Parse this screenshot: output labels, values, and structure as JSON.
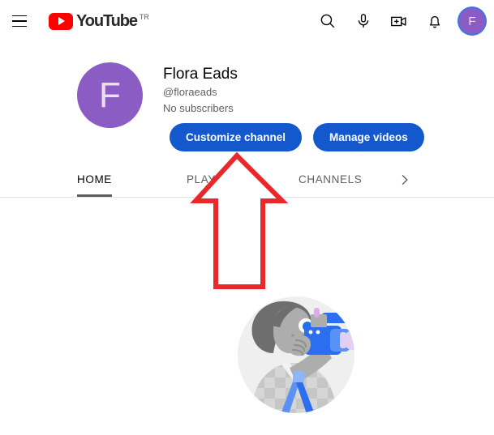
{
  "masthead": {
    "menu_icon": "hamburger-menu-icon",
    "logo_text": "YouTube",
    "country_code": "TR",
    "icons": [
      {
        "name": "search-icon",
        "label": "Search"
      },
      {
        "name": "microphone-icon",
        "label": "Search with your voice"
      },
      {
        "name": "create-video-icon",
        "label": "Create"
      },
      {
        "name": "notifications-bell-icon",
        "label": "Notifications"
      }
    ],
    "account_avatar_letter": "F"
  },
  "channel": {
    "avatar_letter": "F",
    "name": "Flora Eads",
    "handle": "@floraeads",
    "subscribers": "No subscribers",
    "buttons": [
      {
        "name": "customize-channel-button",
        "label": "Customize channel"
      },
      {
        "name": "manage-videos-button",
        "label": "Manage videos"
      }
    ]
  },
  "tabs": {
    "items": [
      {
        "label": "HOME",
        "active": true
      },
      {
        "label": "PLAYLISTS",
        "active": false
      },
      {
        "label": "CHANNELS",
        "active": false
      }
    ],
    "more_icon": "chevron-right-icon"
  },
  "annotation": {
    "icon": "red-up-arrow-annotation",
    "color": "#E8282B",
    "points_to": "Customize channel"
  },
  "illustration": {
    "name": "videographer-with-camera-illustration",
    "colors": {
      "backdrop": "#EEEEEE",
      "hair": "#6E6E6E",
      "skin": "#ACACAC",
      "shirt_light": "#E0E0E0",
      "shirt_dark": "#BDBDBD",
      "camera_blue": "#2B6FF0",
      "camera_light_blue": "#5B90F5",
      "lens_lavender": "#E2CFF2",
      "eye_blue": "#1A73E8"
    }
  },
  "theme": {
    "brand_red": "#FF0000",
    "button_blue": "#1359CD",
    "avatar_purple": "#8A5CC4",
    "text_primary": "#030303",
    "text_secondary": "#606060",
    "divider": "#E5E5E5"
  }
}
